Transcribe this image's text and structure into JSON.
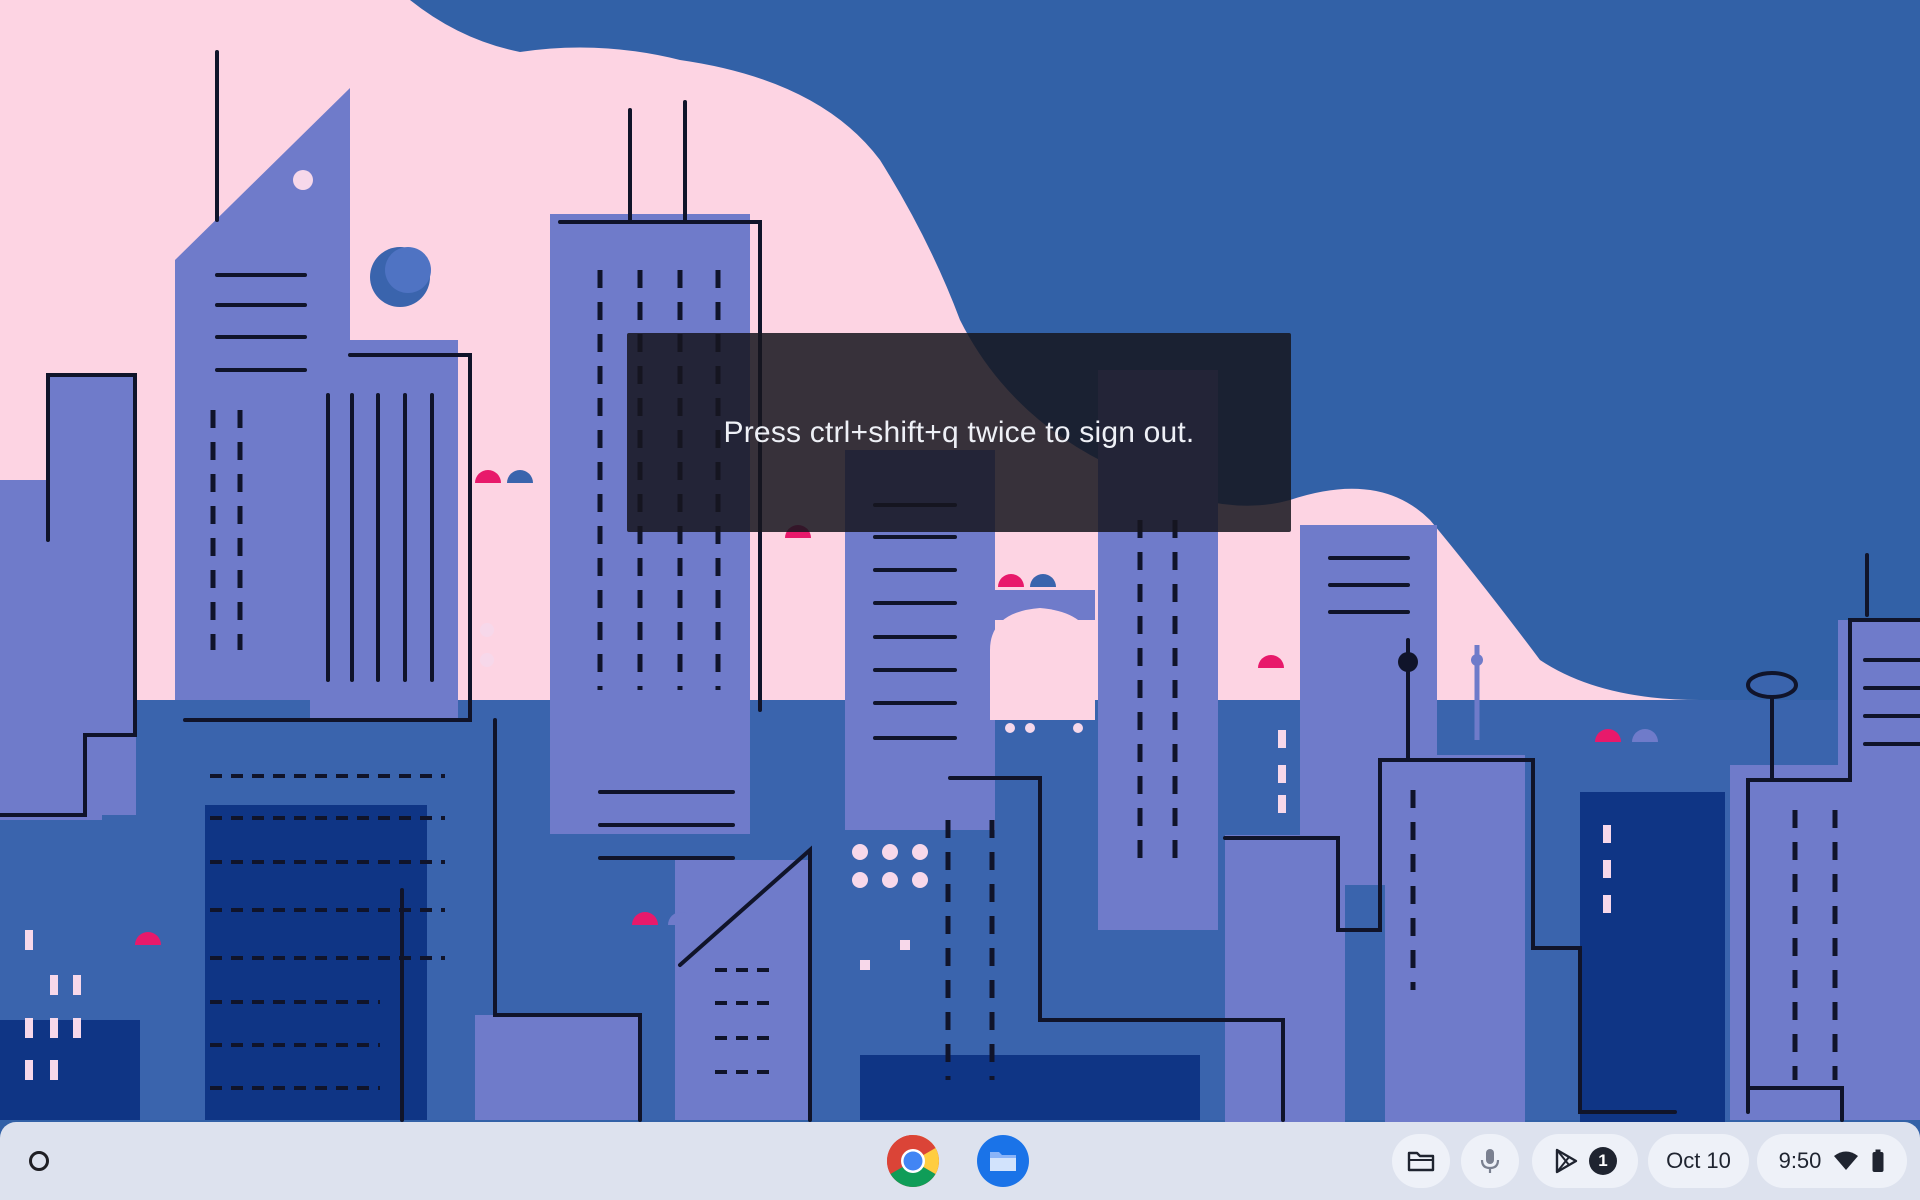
{
  "toast": {
    "message": "Press ctrl+shift+q twice to sign out."
  },
  "shelf": {
    "pinned_apps": [
      {
        "name": "Google Chrome",
        "icon": "chrome-icon"
      },
      {
        "name": "Files",
        "icon": "files-icon"
      }
    ],
    "tray": {
      "holding_space_icon": "folder-icon",
      "mic_icon": "microphone-icon",
      "cast_icon": "play-store-icon",
      "notification_count": "1",
      "date": "Oct 10",
      "time": "9:50",
      "wifi_icon": "wifi-icon",
      "battery_icon": "battery-icon"
    }
  },
  "colors": {
    "sky_blue": "#3261a7",
    "sky_pink": "#fdd4e3",
    "building_light": "#6f7bca",
    "building_mid": "#3a64ad",
    "building_dark": "#0f3585",
    "shelf": "#dde2ee",
    "accent_pink": "#e8196b"
  }
}
